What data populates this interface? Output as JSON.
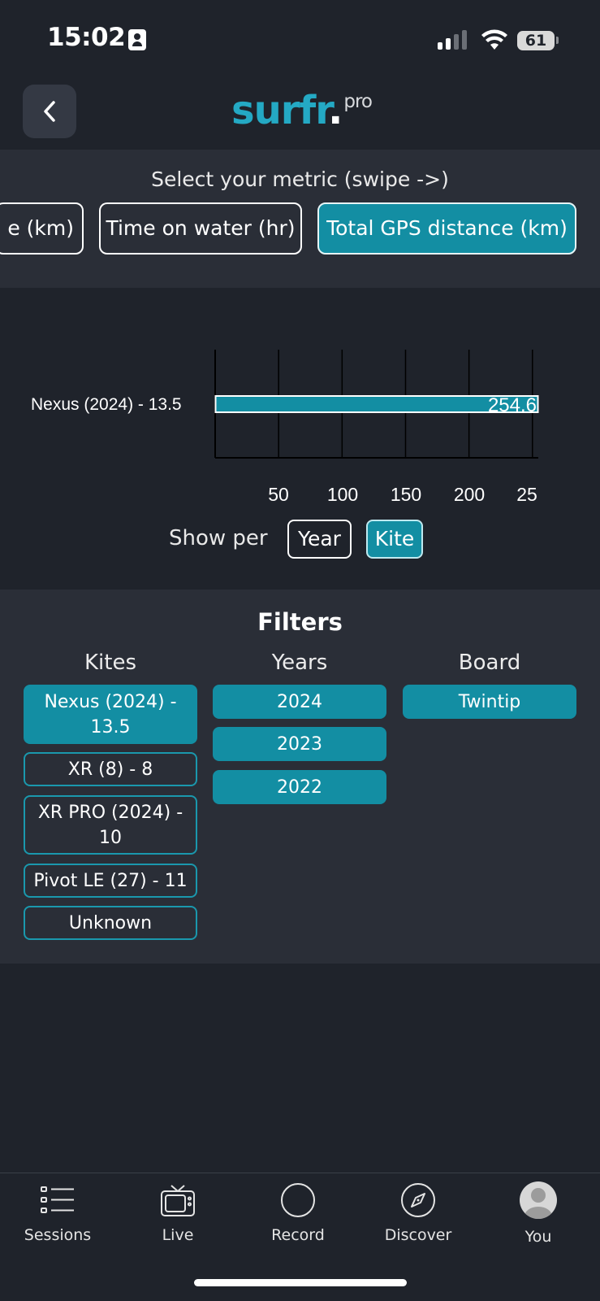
{
  "status_bar": {
    "time": "15:02",
    "battery": "61"
  },
  "header": {
    "logo_main": "surfr",
    "logo_dot": ".",
    "logo_suffix": "pro"
  },
  "metric": {
    "title": "Select your metric (swipe ->)",
    "options": [
      {
        "label": "e  (km)",
        "active": false
      },
      {
        "label": "Time on water (hr)",
        "active": false
      },
      {
        "label": "Total GPS distance  (km)",
        "active": true
      }
    ]
  },
  "chart_data": {
    "type": "bar",
    "orientation": "horizontal",
    "categories": [
      "Nexus (2024) - 13.5"
    ],
    "values": [
      254.6
    ],
    "data_labels": [
      "254.6"
    ],
    "x_ticks": [
      "50",
      "100",
      "150",
      "200",
      "25"
    ],
    "x_tick_values": [
      50,
      100,
      150,
      200,
      250
    ],
    "xlim": [
      0,
      254.6
    ],
    "grid": true,
    "colors": {
      "bar": "#138ea3",
      "bar_border": "#ffffff",
      "grid": "#000000"
    }
  },
  "show_per": {
    "label": "Show per",
    "options": [
      {
        "label": "Year",
        "active": false
      },
      {
        "label": "Kite",
        "active": true
      }
    ]
  },
  "filters": {
    "title": "Filters",
    "kites": {
      "header": "Kites",
      "items": [
        {
          "label": "Nexus (2024) - 13.5",
          "active": true
        },
        {
          "label": "XR (8) - 8",
          "active": false
        },
        {
          "label": "XR PRO (2024) - 10",
          "active": false
        },
        {
          "label": "Pivot LE (27) - 11",
          "active": false
        },
        {
          "label": "Unknown",
          "active": false
        }
      ]
    },
    "years": {
      "header": "Years",
      "items": [
        {
          "label": "2024",
          "active": true
        },
        {
          "label": "2023",
          "active": true
        },
        {
          "label": "2022",
          "active": true
        }
      ]
    },
    "board": {
      "header": "Board",
      "items": [
        {
          "label": "Twintip",
          "active": true
        }
      ]
    }
  },
  "nav": {
    "items": [
      {
        "label": "Sessions",
        "icon": "list-icon"
      },
      {
        "label": "Live",
        "icon": "tv-icon"
      },
      {
        "label": "Record",
        "icon": "record-circle-icon"
      },
      {
        "label": "Discover",
        "icon": "compass-icon"
      },
      {
        "label": "You",
        "icon": "avatar-icon"
      }
    ]
  },
  "colors": {
    "background": "#1f232b",
    "panel": "#2a2e37",
    "accent": "#138ea3",
    "logo": "#24a9c4"
  }
}
